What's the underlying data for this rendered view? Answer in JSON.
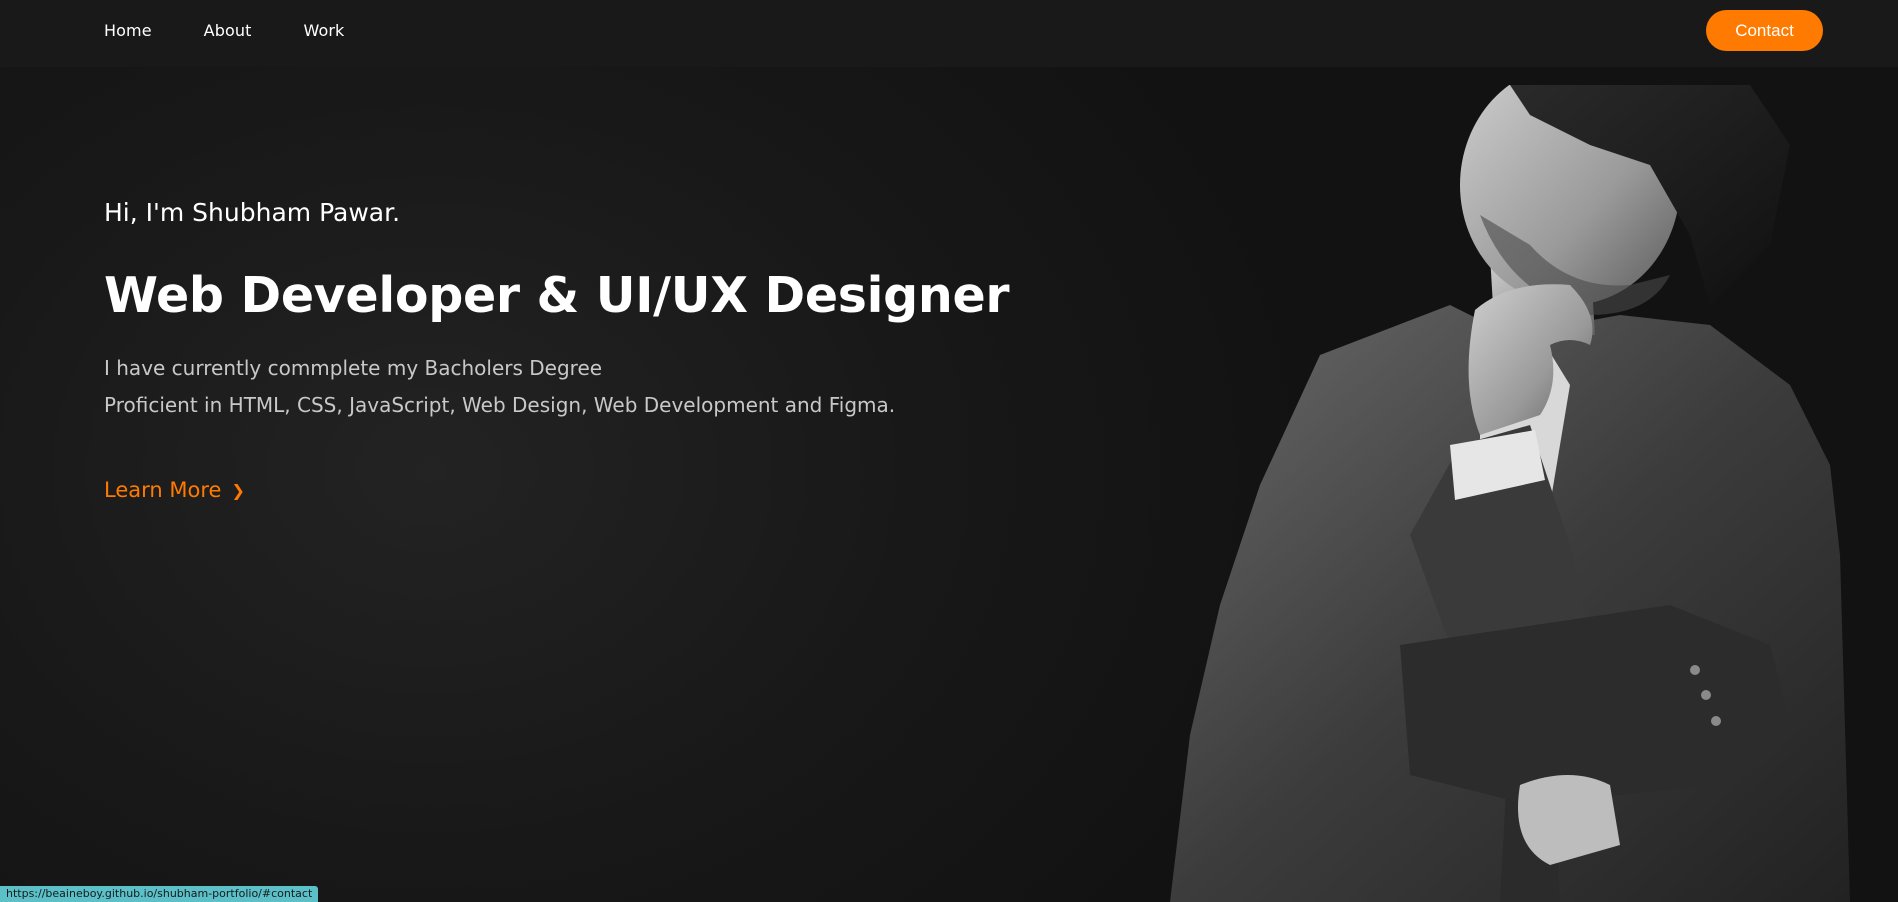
{
  "nav": {
    "links": [
      "Home",
      "About",
      "Work"
    ],
    "contact_label": "Contact"
  },
  "hero": {
    "greeting": "Hi, I'm Shubham Pawar.",
    "headline": "Web Developer & UI/UX Designer",
    "desc_line1": "I have currently commplete my Bacholers Degree",
    "desc_line2": "Proficient in HTML, CSS, JavaScript, Web Design, Web Development and Figma.",
    "learn_more_label": "Learn More",
    "learn_more_chevron": "❯"
  },
  "status": {
    "url": "https://beaineboy.github.io/shubham-portfolio/#contact"
  },
  "colors": {
    "accent": "#ff7a00",
    "background": "#141414",
    "navbar": "#191919"
  },
  "icons": {
    "learn_more_icon": "chevron-right-icon"
  }
}
